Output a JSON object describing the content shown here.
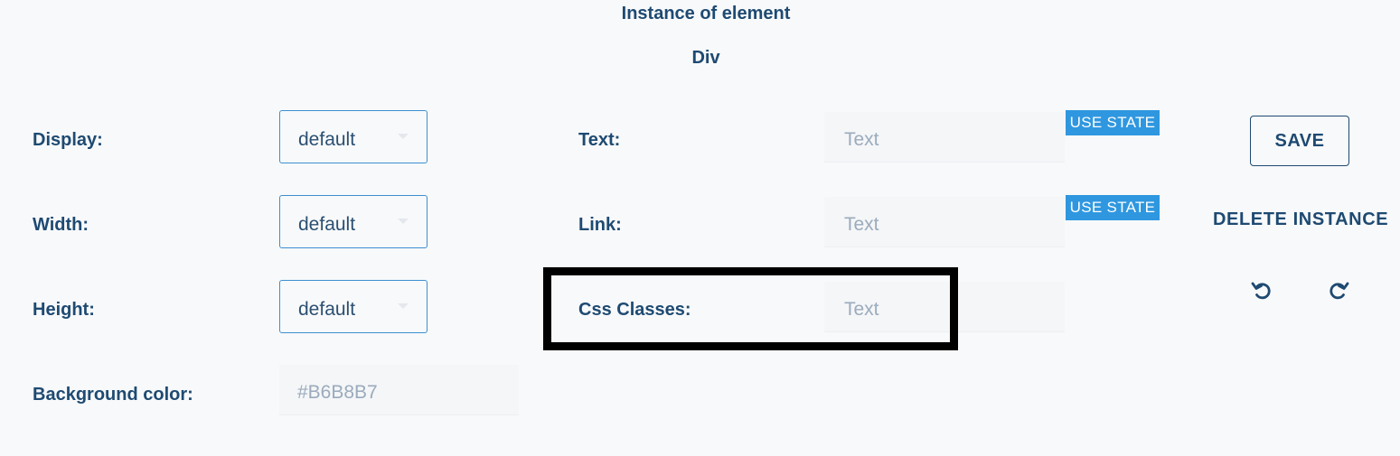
{
  "header": {
    "title": "Instance of element",
    "subtitle": "Div"
  },
  "left_form": {
    "display": {
      "label": "Display:",
      "value": "default"
    },
    "width": {
      "label": "Width:",
      "value": "default"
    },
    "height": {
      "label": "Height:",
      "value": "default"
    },
    "background": {
      "label": "Background color:",
      "value": "#B6B8B7"
    }
  },
  "middle_form": {
    "text": {
      "label": "Text:",
      "placeholder": "Text",
      "use_state": "USE STATE"
    },
    "link": {
      "label": "Link:",
      "placeholder": "Text",
      "use_state": "USE STATE"
    },
    "css_classes": {
      "label": "Css Classes:",
      "placeholder": "Text"
    }
  },
  "actions": {
    "save_label": "SAVE",
    "delete_label": "DELETE INSTANCE",
    "undo_icon": "undo-icon",
    "redo_icon": "redo-icon"
  },
  "colors": {
    "primary_text": "#1e4a72",
    "accent_blue": "#2f97df",
    "select_border": "#3c8fd1",
    "highlight": "#000000"
  }
}
